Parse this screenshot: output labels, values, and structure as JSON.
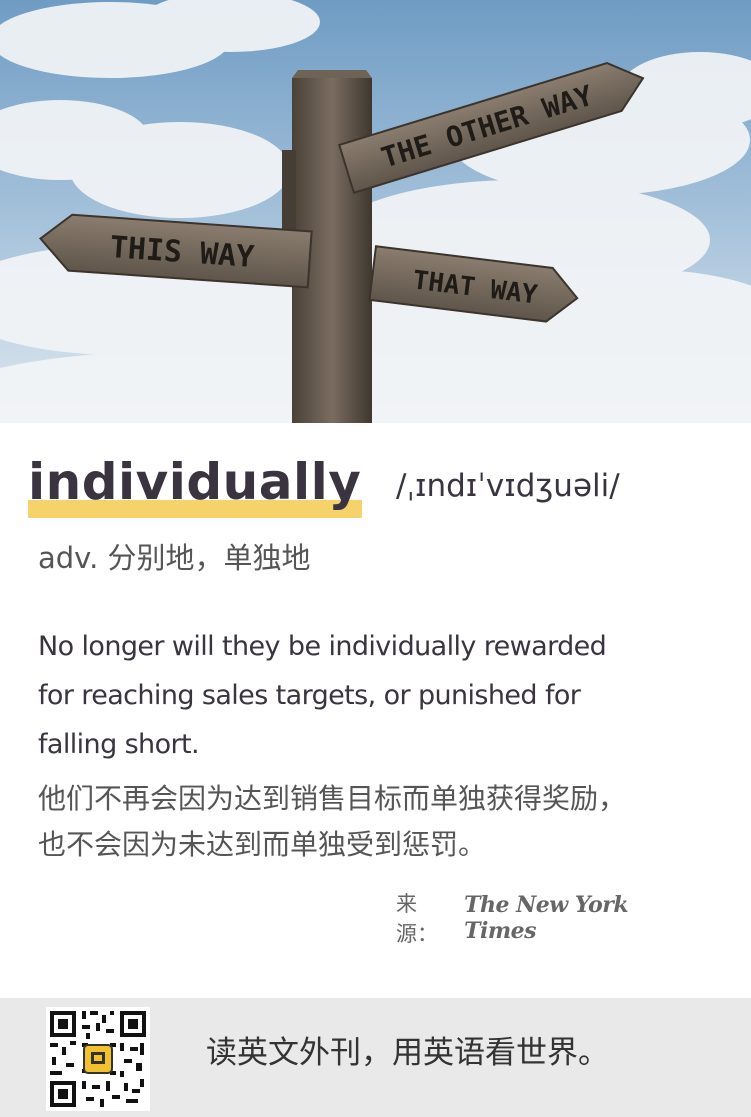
{
  "hero": {
    "signs": {
      "top": "THE OTHER WAY",
      "left": "THIS WAY",
      "right": "THAT WAY"
    }
  },
  "word": {
    "headword": "individually",
    "phonetic": "/ˌɪndɪˈvɪdʒuəli/",
    "definition": "adv. 分别地，单独地"
  },
  "example": {
    "english_lines": [
      "No longer will they be individually rewarded",
      "for reaching sales targets, or punished for",
      "falling short."
    ],
    "chinese_lines": [
      "他们不再会因为达到销售目标而单独获得奖励，",
      "也不会因为未达到而单独受到惩罚。"
    ]
  },
  "source": {
    "label": "来源：",
    "publication": "The New York Times"
  },
  "footer": {
    "slogan": "读英文外刊，用英语看世界。"
  },
  "colors": {
    "highlight": "#f6d36a",
    "heading_text": "#3a3440",
    "footer_bg": "#e9e9e9"
  }
}
